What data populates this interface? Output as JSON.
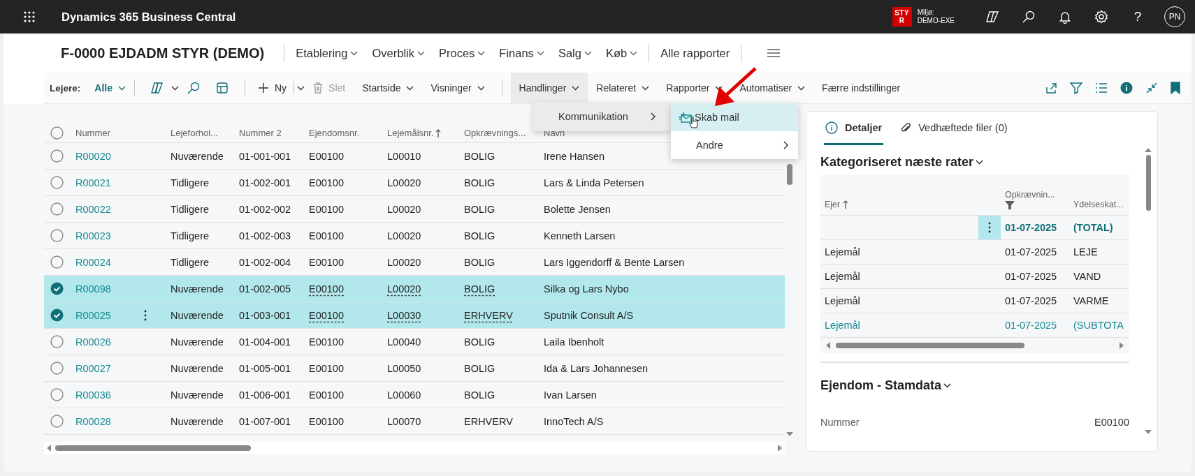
{
  "app_bar": {
    "title": "Dynamics 365 Business Central",
    "environment_badge": "STYR",
    "environment_label": "Miljø:",
    "environment_name": "DEMO-EXE",
    "help": "?",
    "user_initials": "PN"
  },
  "page": {
    "title": "F-0000 EJDADM STYR (DEMO)",
    "nav": [
      {
        "label": "Etablering",
        "dropdown": true
      },
      {
        "label": "Overblik",
        "dropdown": true
      },
      {
        "label": "Proces",
        "dropdown": true
      },
      {
        "label": "Finans",
        "dropdown": true
      },
      {
        "label": "Salg",
        "dropdown": true
      },
      {
        "label": "Køb",
        "dropdown": true
      },
      {
        "label": "Alle rapporter",
        "dropdown": false
      }
    ]
  },
  "command_bar": {
    "filter_label": "Lejere:",
    "filter_value": "Alle",
    "new_label": "Ny",
    "delete": {
      "label": "Slet",
      "disabled": true
    },
    "view_menus": [
      {
        "label": "Startside",
        "expanded": false
      },
      {
        "label": "Visninger",
        "expanded": false
      }
    ],
    "action_menus": [
      {
        "label": "Handlinger",
        "expanded": true
      },
      {
        "label": "Relateret",
        "expanded": false
      },
      {
        "label": "Rapporter",
        "expanded": false
      },
      {
        "label": "Automatiser",
        "expanded": false
      }
    ],
    "less_options": "Færre indstillinger"
  },
  "open_menu": {
    "items": [
      {
        "label": "Kommunikation",
        "kind": "submenu"
      }
    ],
    "submenu": [
      {
        "label": "Skab mail",
        "kind": "action",
        "hovered": true
      },
      {
        "label": "Andre",
        "kind": "submenu",
        "hovered": false
      }
    ]
  },
  "table": {
    "all_selected": false,
    "columns": [
      {
        "label": "Nummer",
        "sorted": false
      },
      {
        "label": "Lejeforhol...",
        "sorted": false
      },
      {
        "label": "Nummer 2",
        "sorted": false
      },
      {
        "label": "Ejendomsnr.",
        "sorted": false
      },
      {
        "label": "Lejemålsnr.",
        "sorted": true
      },
      {
        "label": "Opkrævnings...",
        "sorted": false
      },
      {
        "label": "Navn",
        "sorted": false
      }
    ],
    "rows": [
      {
        "selected": false,
        "row_menu": false,
        "cells": [
          "R00020",
          "Nuværende",
          "01-001-001",
          "E00100",
          "L00010",
          "BOLIG",
          "Irene Hansen"
        ]
      },
      {
        "selected": false,
        "row_menu": false,
        "cells": [
          "R00021",
          "Tidligere",
          "01-002-001",
          "E00100",
          "L00020",
          "BOLIG",
          "Lars & Linda Petersen"
        ]
      },
      {
        "selected": false,
        "row_menu": false,
        "cells": [
          "R00022",
          "Tidligere",
          "01-002-002",
          "E00100",
          "L00020",
          "BOLIG",
          "Bolette Jensen"
        ]
      },
      {
        "selected": false,
        "row_menu": false,
        "cells": [
          "R00023",
          "Tidligere",
          "01-002-003",
          "E00100",
          "L00020",
          "BOLIG",
          "Kenneth Larsen"
        ]
      },
      {
        "selected": false,
        "row_menu": false,
        "cells": [
          "R00024",
          "Tidligere",
          "01-002-004",
          "E00100",
          "L00020",
          "BOLIG",
          "Lars Iggendorff & Bente Larsen"
        ]
      },
      {
        "selected": true,
        "row_menu": false,
        "cells": [
          "R00098",
          "Nuværende",
          "01-002-005",
          "E00100",
          "L00020",
          "BOLIG",
          "Silka og Lars Nybo"
        ]
      },
      {
        "selected": true,
        "row_menu": true,
        "cells": [
          "R00025",
          "Nuværende",
          "01-003-001",
          "E00100",
          "L00030",
          "ERHVERV",
          "Sputnik Consult A/S"
        ]
      },
      {
        "selected": false,
        "row_menu": false,
        "cells": [
          "R00026",
          "Nuværende",
          "01-004-001",
          "E00100",
          "L00040",
          "BOLIG",
          "Laila Ibenholt"
        ]
      },
      {
        "selected": false,
        "row_menu": false,
        "cells": [
          "R00027",
          "Nuværende",
          "01-005-001",
          "E00100",
          "L00050",
          "BOLIG",
          "Ida & Lars Johannesen"
        ]
      },
      {
        "selected": false,
        "row_menu": false,
        "cells": [
          "R00036",
          "Nuværende",
          "01-006-001",
          "E00100",
          "L00060",
          "BOLIG",
          "Ivan Larsen"
        ]
      },
      {
        "selected": false,
        "row_menu": false,
        "cells": [
          "R00028",
          "Nuværende",
          "01-007-001",
          "E00100",
          "L00070",
          "ERHVERV",
          "InnoTech A/S"
        ]
      }
    ]
  },
  "factbox": {
    "tabs": [
      {
        "label": "Detaljer",
        "selected": true
      },
      {
        "label": "Vedhæftede filer (0)",
        "selected": false
      }
    ],
    "rates": {
      "title": "Kategoriseret næste rater",
      "columns": [
        {
          "label": "Ejer",
          "sorted": true,
          "filtered": false
        },
        {
          "label": "Opkrævnin...",
          "sorted": false,
          "filtered": true
        },
        {
          "label": "Ydelseskat...",
          "sorted": false,
          "filtered": false
        }
      ],
      "rows": [
        {
          "kind": "total",
          "row_menu": true,
          "date": "01-07-2025",
          "category": "(TOTAL)"
        },
        {
          "kind": "line",
          "row_menu": false,
          "owner": "Lejemål",
          "date": "01-07-2025",
          "category": "LEJE"
        },
        {
          "kind": "line",
          "row_menu": false,
          "owner": "Lejemål",
          "date": "01-07-2025",
          "category": "VAND"
        },
        {
          "kind": "line",
          "row_menu": false,
          "owner": "Lejemål",
          "date": "01-07-2025",
          "category": "VARME"
        },
        {
          "kind": "subtotal",
          "row_menu": false,
          "owner": "Lejemål",
          "date": "01-07-2025",
          "category": "(SUBTOTA"
        }
      ]
    },
    "property": {
      "title": "Ejendom - Stamdata",
      "fields": [
        {
          "label": "Nummer",
          "value": "E00100"
        }
      ]
    }
  }
}
